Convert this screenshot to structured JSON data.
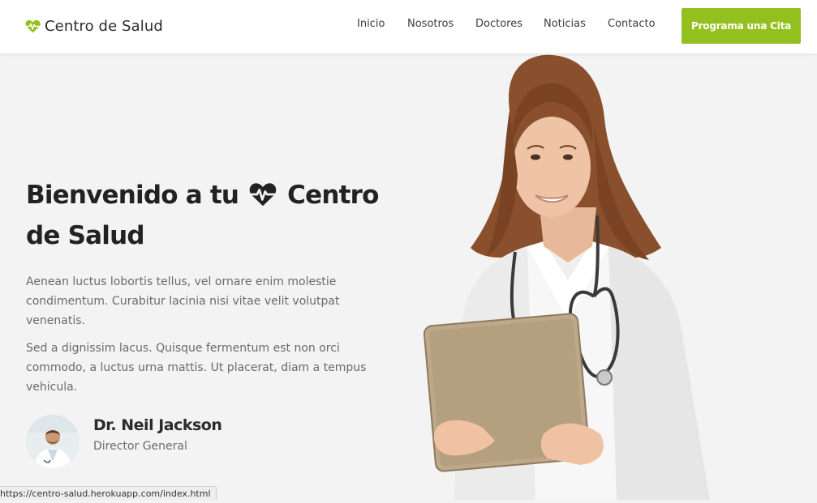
{
  "brand": {
    "name": "Centro de Salud",
    "icon": "heartbeat-icon",
    "accent_color": "#93c01f"
  },
  "nav": {
    "links": [
      "Inicio",
      "Nosotros",
      "Doctores",
      "Noticias",
      "Contacto"
    ],
    "cta_label": "Programa una Cita"
  },
  "hero": {
    "title_part1": "Bienvenido a tu",
    "title_part2": "Centro de Salud",
    "title_icon": "heartbeat-icon",
    "paragraph1": "Aenean luctus lobortis tellus, vel ornare enim molestie condimentum. Curabitur lacinia nisi vitae velit volutpat venenatis.",
    "paragraph2": "Sed a dignissim lacus. Quisque fermentum est non orci commodo, a luctus urna mattis. Ut placerat, diam a tempus vehicula.",
    "doctor": {
      "name": "Dr. Neil Jackson",
      "role": "Director General"
    }
  },
  "status_bar": {
    "url": "https://centro-salud.herokuapp.com/index.html"
  }
}
